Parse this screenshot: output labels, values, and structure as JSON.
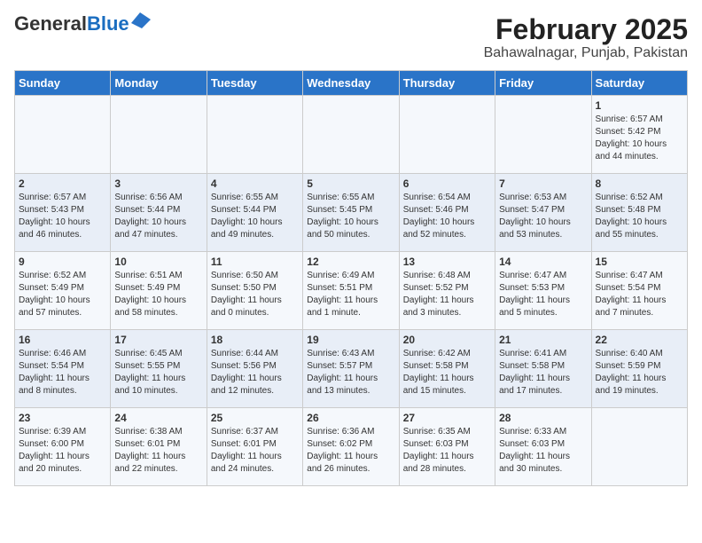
{
  "header": {
    "logo_general": "General",
    "logo_blue": "Blue",
    "title": "February 2025",
    "subtitle": "Bahawalnagar, Punjab, Pakistan"
  },
  "days_of_week": [
    "Sunday",
    "Monday",
    "Tuesday",
    "Wednesday",
    "Thursday",
    "Friday",
    "Saturday"
  ],
  "weeks": [
    [
      {
        "day": "",
        "info": ""
      },
      {
        "day": "",
        "info": ""
      },
      {
        "day": "",
        "info": ""
      },
      {
        "day": "",
        "info": ""
      },
      {
        "day": "",
        "info": ""
      },
      {
        "day": "",
        "info": ""
      },
      {
        "day": "1",
        "info": "Sunrise: 6:57 AM\nSunset: 5:42 PM\nDaylight: 10 hours\nand 44 minutes."
      }
    ],
    [
      {
        "day": "2",
        "info": "Sunrise: 6:57 AM\nSunset: 5:43 PM\nDaylight: 10 hours\nand 46 minutes."
      },
      {
        "day": "3",
        "info": "Sunrise: 6:56 AM\nSunset: 5:44 PM\nDaylight: 10 hours\nand 47 minutes."
      },
      {
        "day": "4",
        "info": "Sunrise: 6:55 AM\nSunset: 5:44 PM\nDaylight: 10 hours\nand 49 minutes."
      },
      {
        "day": "5",
        "info": "Sunrise: 6:55 AM\nSunset: 5:45 PM\nDaylight: 10 hours\nand 50 minutes."
      },
      {
        "day": "6",
        "info": "Sunrise: 6:54 AM\nSunset: 5:46 PM\nDaylight: 10 hours\nand 52 minutes."
      },
      {
        "day": "7",
        "info": "Sunrise: 6:53 AM\nSunset: 5:47 PM\nDaylight: 10 hours\nand 53 minutes."
      },
      {
        "day": "8",
        "info": "Sunrise: 6:52 AM\nSunset: 5:48 PM\nDaylight: 10 hours\nand 55 minutes."
      }
    ],
    [
      {
        "day": "9",
        "info": "Sunrise: 6:52 AM\nSunset: 5:49 PM\nDaylight: 10 hours\nand 57 minutes."
      },
      {
        "day": "10",
        "info": "Sunrise: 6:51 AM\nSunset: 5:49 PM\nDaylight: 10 hours\nand 58 minutes."
      },
      {
        "day": "11",
        "info": "Sunrise: 6:50 AM\nSunset: 5:50 PM\nDaylight: 11 hours\nand 0 minutes."
      },
      {
        "day": "12",
        "info": "Sunrise: 6:49 AM\nSunset: 5:51 PM\nDaylight: 11 hours\nand 1 minute."
      },
      {
        "day": "13",
        "info": "Sunrise: 6:48 AM\nSunset: 5:52 PM\nDaylight: 11 hours\nand 3 minutes."
      },
      {
        "day": "14",
        "info": "Sunrise: 6:47 AM\nSunset: 5:53 PM\nDaylight: 11 hours\nand 5 minutes."
      },
      {
        "day": "15",
        "info": "Sunrise: 6:47 AM\nSunset: 5:54 PM\nDaylight: 11 hours\nand 7 minutes."
      }
    ],
    [
      {
        "day": "16",
        "info": "Sunrise: 6:46 AM\nSunset: 5:54 PM\nDaylight: 11 hours\nand 8 minutes."
      },
      {
        "day": "17",
        "info": "Sunrise: 6:45 AM\nSunset: 5:55 PM\nDaylight: 11 hours\nand 10 minutes."
      },
      {
        "day": "18",
        "info": "Sunrise: 6:44 AM\nSunset: 5:56 PM\nDaylight: 11 hours\nand 12 minutes."
      },
      {
        "day": "19",
        "info": "Sunrise: 6:43 AM\nSunset: 5:57 PM\nDaylight: 11 hours\nand 13 minutes."
      },
      {
        "day": "20",
        "info": "Sunrise: 6:42 AM\nSunset: 5:58 PM\nDaylight: 11 hours\nand 15 minutes."
      },
      {
        "day": "21",
        "info": "Sunrise: 6:41 AM\nSunset: 5:58 PM\nDaylight: 11 hours\nand 17 minutes."
      },
      {
        "day": "22",
        "info": "Sunrise: 6:40 AM\nSunset: 5:59 PM\nDaylight: 11 hours\nand 19 minutes."
      }
    ],
    [
      {
        "day": "23",
        "info": "Sunrise: 6:39 AM\nSunset: 6:00 PM\nDaylight: 11 hours\nand 20 minutes."
      },
      {
        "day": "24",
        "info": "Sunrise: 6:38 AM\nSunset: 6:01 PM\nDaylight: 11 hours\nand 22 minutes."
      },
      {
        "day": "25",
        "info": "Sunrise: 6:37 AM\nSunset: 6:01 PM\nDaylight: 11 hours\nand 24 minutes."
      },
      {
        "day": "26",
        "info": "Sunrise: 6:36 AM\nSunset: 6:02 PM\nDaylight: 11 hours\nand 26 minutes."
      },
      {
        "day": "27",
        "info": "Sunrise: 6:35 AM\nSunset: 6:03 PM\nDaylight: 11 hours\nand 28 minutes."
      },
      {
        "day": "28",
        "info": "Sunrise: 6:33 AM\nSunset: 6:03 PM\nDaylight: 11 hours\nand 30 minutes."
      },
      {
        "day": "",
        "info": ""
      }
    ]
  ]
}
